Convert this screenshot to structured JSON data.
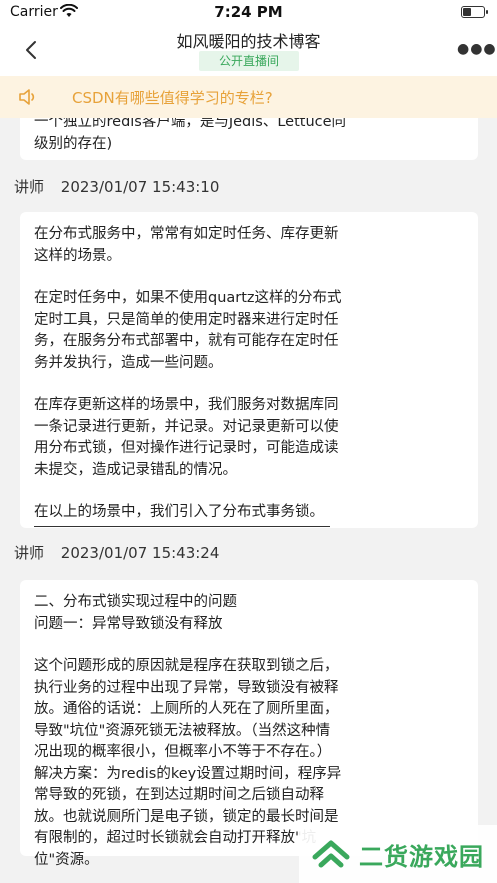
{
  "status_bar": {
    "carrier": "Carrier",
    "time": "7:24 PM"
  },
  "nav": {
    "title": "如风暖阳的技术博客",
    "badge": "公开直播间"
  },
  "notice": {
    "text": "CSDN有哪些值得学习的专栏?"
  },
  "messages": [
    {
      "lines": [
        "一个独立的redis客户端，是与Jedis、Lettuce同",
        "级别的存在)"
      ]
    },
    {
      "sender": "讲师",
      "time": "2023/01/07 15:43:10",
      "paragraphs": [
        "在分布式服务中，常常有如定时任务、库存更新\n这样的场景。",
        "在定时任务中，如果不使用quartz这样的分布式\n定时工具，只是简单的使用定时器来进行定时任\n务，在服务分布式部署中，就有可能存在定时任\n务并发执行，造成一些问题。",
        "在库存更新这样的场景中，我们服务对数据库同\n一条记录进行更新，并记录。对记录更新可以使\n用分布式锁，但对操作进行记录时，可能造成读\n未提交，造成记录错乱的情况。",
        "在以上的场景中，我们引入了分布式事务锁。"
      ]
    },
    {
      "sender": "讲师",
      "time": "2023/01/07 15:43:24",
      "paragraphs": [
        "二、分布式锁实现过程中的问题\n问题一：异常导致锁没有释放",
        "这个问题形成的原因就是程序在获取到锁之后，\n执行业务的过程中出现了异常，导致锁没有被释\n放。通俗的话说：上厕所的人死在了厕所里面，\n导致\"坑位\"资源死锁无法被释放。（当然这种情\n况出现的概率很小，但概率小不等于不存在。）\n解决方案：为redis的key设置过期时间，程序异\n常导致的死锁，在到达过期时间之后锁自动释\n放。也就说厕所门是电子锁，锁定的最长时间是\n有限制的，超过时长锁就会自动打开释放\"坑\n位\"资源。"
      ]
    }
  ],
  "watermark": {
    "text": "二货游戏园"
  },
  "colors": {
    "accent_green": "#3aa85c",
    "notice_bg": "#fdf3e1",
    "notice_text": "#e7a23a"
  },
  "icons": [
    "wifi-icon",
    "battery-icon",
    "back-chevron-icon",
    "more-icon",
    "speaker-icon",
    "logo-icon"
  ]
}
